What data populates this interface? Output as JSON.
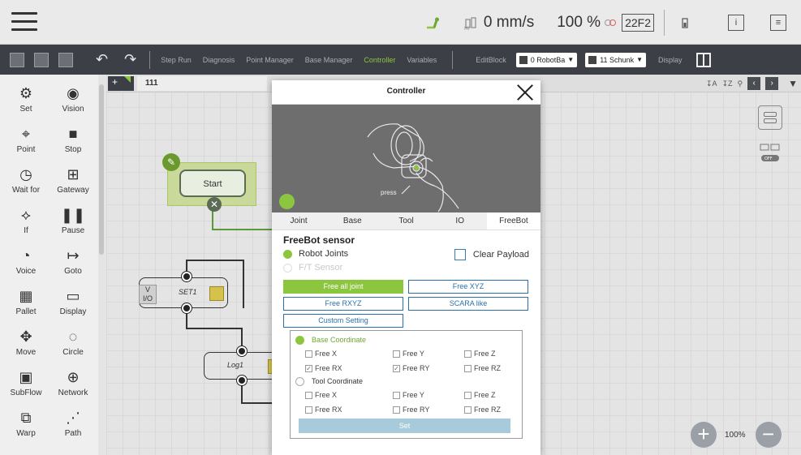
{
  "statusbar": {
    "speed": "0 mm/s",
    "percent": "100 %",
    "badge": "22F2",
    "info_icon": "i"
  },
  "toolbar": {
    "menu": [
      "Step Run",
      "Diagnosis",
      "Point Manager",
      "Base Manager",
      "Controller",
      "Variables"
    ],
    "active_menu": "Controller",
    "editblock": "EditBlock",
    "base_select": "0 RobotBa",
    "tool_select": "11 Schunk",
    "display": "Display"
  },
  "palette": {
    "items": [
      {
        "label": "Set",
        "icon": "set-icon"
      },
      {
        "label": "Vision",
        "icon": "vision-icon"
      },
      {
        "label": "Point",
        "icon": "point-icon"
      },
      {
        "label": "Stop",
        "icon": "stop-icon"
      },
      {
        "label": "Wait for",
        "icon": "wait-icon"
      },
      {
        "label": "Gateway",
        "icon": "gateway-icon"
      },
      {
        "label": "If",
        "icon": "if-icon"
      },
      {
        "label": "Pause",
        "icon": "pause-icon"
      },
      {
        "label": "Voice",
        "icon": "voice-icon"
      },
      {
        "label": "Goto",
        "icon": "goto-icon"
      },
      {
        "label": "Pallet",
        "icon": "pallet-icon"
      },
      {
        "label": "Display",
        "icon": "display-icon"
      },
      {
        "label": "Move",
        "icon": "move-icon"
      },
      {
        "label": "Circle",
        "icon": "circle-icon"
      },
      {
        "label": "SubFlow",
        "icon": "subflow-icon"
      },
      {
        "label": "Network",
        "icon": "network-icon"
      },
      {
        "label": "Warp",
        "icon": "warp-icon"
      },
      {
        "label": "Path",
        "icon": "path-icon"
      }
    ]
  },
  "workspace": {
    "plus": "+",
    "tab": "111",
    "start_label": "Start",
    "set_node": "SET1",
    "vio_top": "V",
    "vio_bottom": "I/O",
    "log_node": "Log1",
    "zoom": "100%"
  },
  "dialog": {
    "title": "Controller",
    "press": "press",
    "tabs": [
      "Joint",
      "Base",
      "Tool",
      "IO",
      "FreeBot"
    ],
    "selected_tab": "FreeBot",
    "sensor_title": "FreeBot sensor",
    "robot_joints": "Robot Joints",
    "ft_sensor": "F/T Sensor",
    "clear_payload": "Clear Payload",
    "buttons": [
      "Free all joint",
      "Free XYZ",
      "Free RXYZ",
      "SCARA like",
      "Custom Setting"
    ],
    "base_coordinate": "Base Coordinate",
    "tool_coordinate": "Tool Coordinate",
    "base_checks": [
      {
        "label": "Free X",
        "checked": false
      },
      {
        "label": "Free Y",
        "checked": false
      },
      {
        "label": "Free Z",
        "checked": false
      },
      {
        "label": "Free RX",
        "checked": true
      },
      {
        "label": "Free RY",
        "checked": true
      },
      {
        "label": "Free RZ",
        "checked": false
      }
    ],
    "tool_checks": [
      {
        "label": "Free X",
        "checked": false
      },
      {
        "label": "Free Y",
        "checked": false
      },
      {
        "label": "Free Z",
        "checked": false
      },
      {
        "label": "Free RX",
        "checked": false
      },
      {
        "label": "Free RY",
        "checked": false
      },
      {
        "label": "Free RZ",
        "checked": false
      }
    ],
    "set_button": "Set"
  },
  "colors": {
    "accent_green": "#8cc63f",
    "toolbar_bg": "#3c4046",
    "link_blue": "#2a6fa8"
  }
}
